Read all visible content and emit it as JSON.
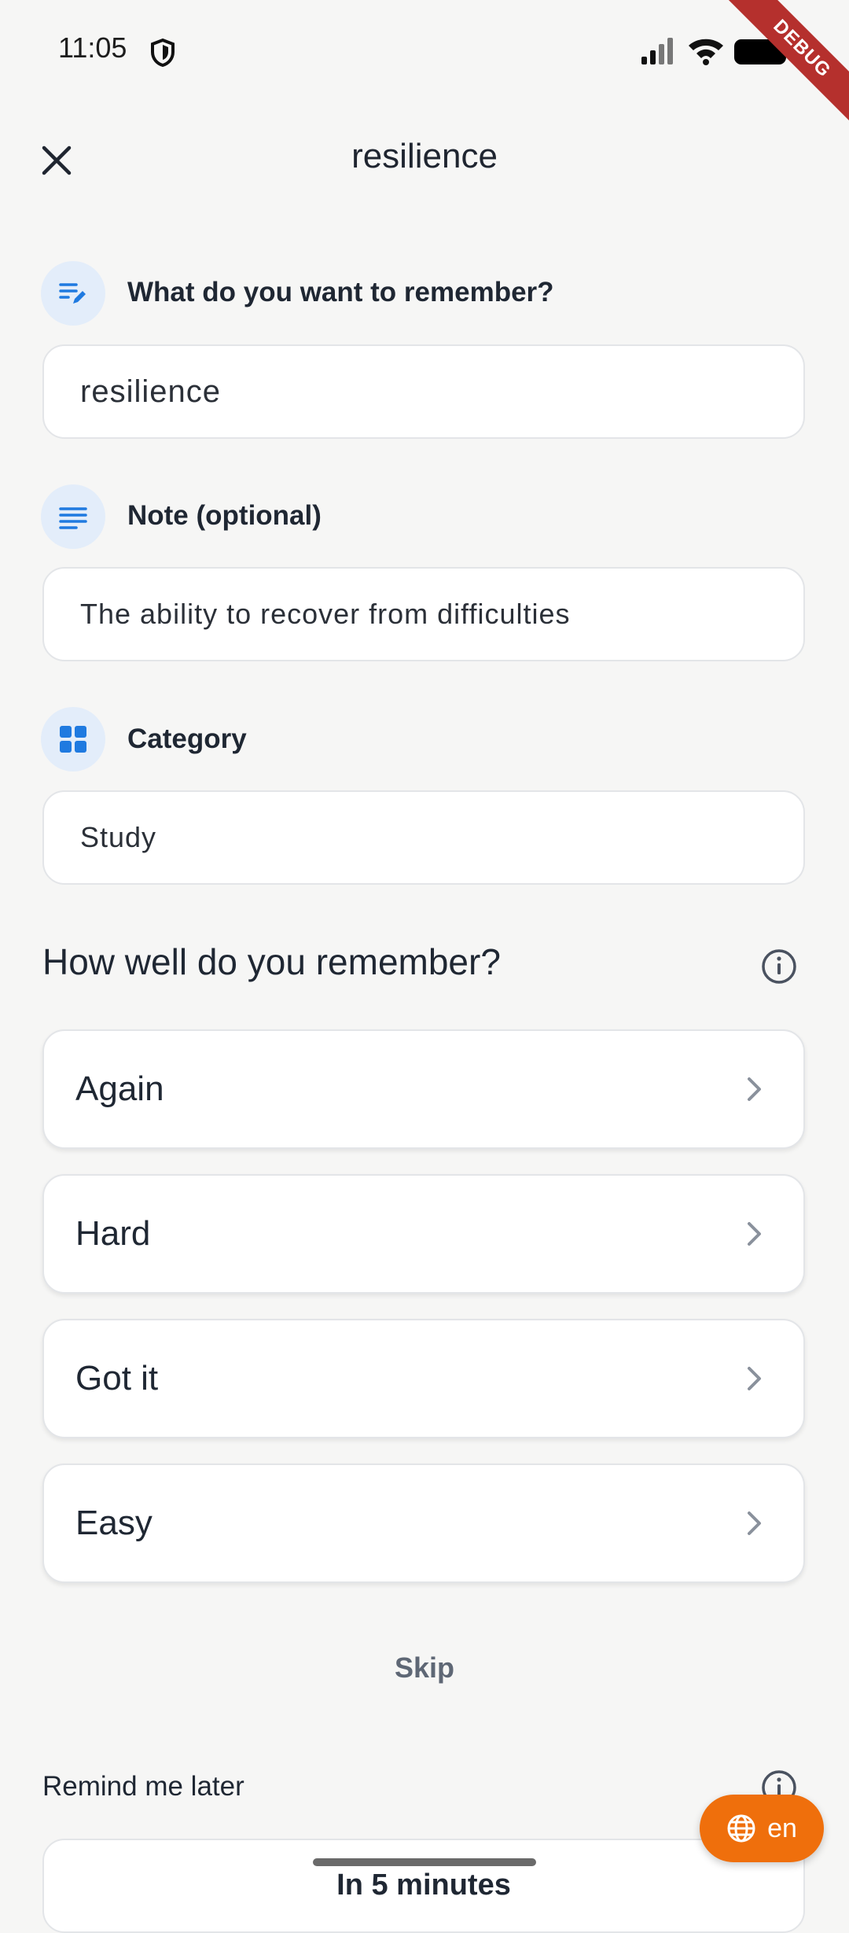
{
  "status_bar": {
    "time": "11:05"
  },
  "debug_banner": "DEBUG",
  "header": {
    "title": "resilience"
  },
  "fields": {
    "remember": {
      "label": "What do you want to remember?",
      "value": "resilience"
    },
    "note": {
      "label": "Note (optional)",
      "value": "The ability to recover from difficulties"
    },
    "category": {
      "label": "Category",
      "value": "Study"
    }
  },
  "rating": {
    "heading": "How well do you remember?",
    "options": [
      {
        "label": "Again"
      },
      {
        "label": "Hard"
      },
      {
        "label": "Got it"
      },
      {
        "label": "Easy"
      }
    ]
  },
  "skip_label": "Skip",
  "remind": {
    "label": "Remind me later",
    "value": "In 5 minutes"
  },
  "language_button": {
    "label": "en"
  },
  "colors": {
    "accent": "#1f7ae0",
    "fab": "#ef6f0c",
    "icon_bg": "#e3edfa"
  }
}
